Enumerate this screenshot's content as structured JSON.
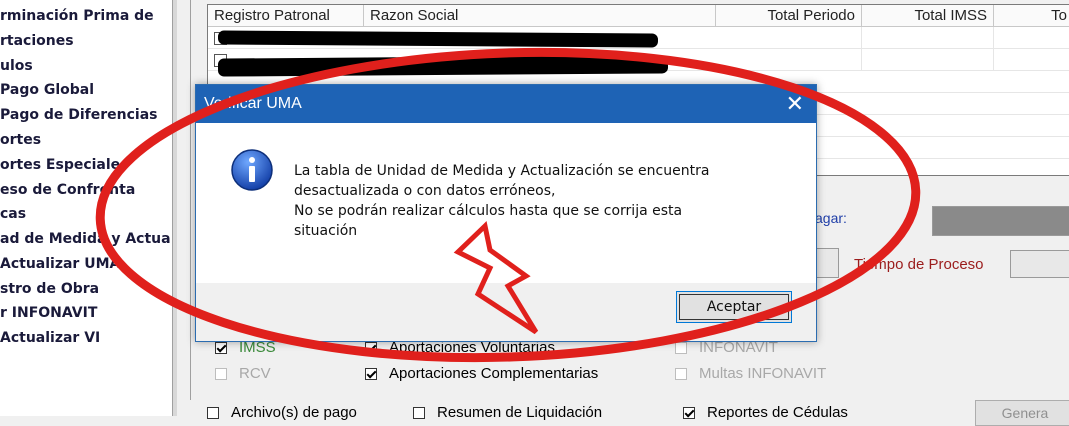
{
  "tree": {
    "items": [
      "rminación Prima de",
      "rtaciones",
      "ulos",
      "Pago Global",
      "Pago de Diferencias",
      "ortes",
      "ortes Especiales",
      "eso de Confronta",
      "cas",
      "ad de Medida y Actua",
      "Actualizar UMA",
      "stro de Obra",
      "r INFONAVIT",
      "Actualizar VI"
    ]
  },
  "grid": {
    "columns": [
      "Registro Patronal",
      "Razon Social",
      "Total Periodo",
      "Total IMSS",
      "To"
    ]
  },
  "panel": {
    "pagar_label": "agar:",
    "tiempo_label": "Tiempo de Proceso",
    "generate_label": "Genera"
  },
  "checks": {
    "imss": "IMSS",
    "rcv": "RCV",
    "aport_vol": "Aportaciones Voluntarias",
    "aport_comp": "Aportaciones Complementarias",
    "infonavit": "INFONAVIT",
    "multas": "Multas INFONAVIT",
    "archivo": "Archivo(s) de pago",
    "resumen": "Resumen de Liquidación",
    "reportes": "Reportes de Cédulas"
  },
  "dialog": {
    "title": "Verificar UMA",
    "close": "✕",
    "message_lines": [
      "La tabla de Unidad de Medida y Actualización se encuentra",
      "desactualizada o con datos erróneos,",
      "No se podrán realizar cálculos hasta que se corrija esta",
      "situación"
    ],
    "ok_label": "Aceptar"
  },
  "colors": {
    "title_bar": "#1e63b5",
    "annotation": "#e0201c"
  }
}
